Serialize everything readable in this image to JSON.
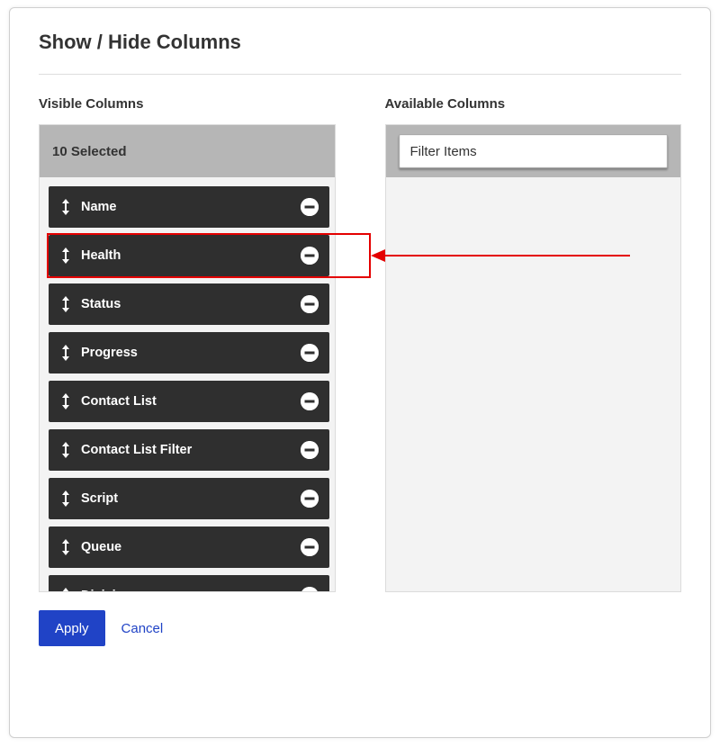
{
  "title": "Show / Hide Columns",
  "left": {
    "heading": "Visible Columns",
    "selected_count_label": "10 Selected"
  },
  "right": {
    "heading": "Available Columns",
    "filter_placeholder": "Filter Items"
  },
  "visible_columns": [
    {
      "label": "Name"
    },
    {
      "label": "Health",
      "highlighted": true
    },
    {
      "label": "Status"
    },
    {
      "label": "Progress"
    },
    {
      "label": "Contact List"
    },
    {
      "label": "Contact List Filter"
    },
    {
      "label": "Script"
    },
    {
      "label": "Queue"
    },
    {
      "label": "Division"
    }
  ],
  "available_columns": [],
  "footer": {
    "apply_label": "Apply",
    "cancel_label": "Cancel"
  },
  "colors": {
    "accent": "#2043c6",
    "highlight": "#e40000",
    "item_bg": "#2f2f2f"
  }
}
